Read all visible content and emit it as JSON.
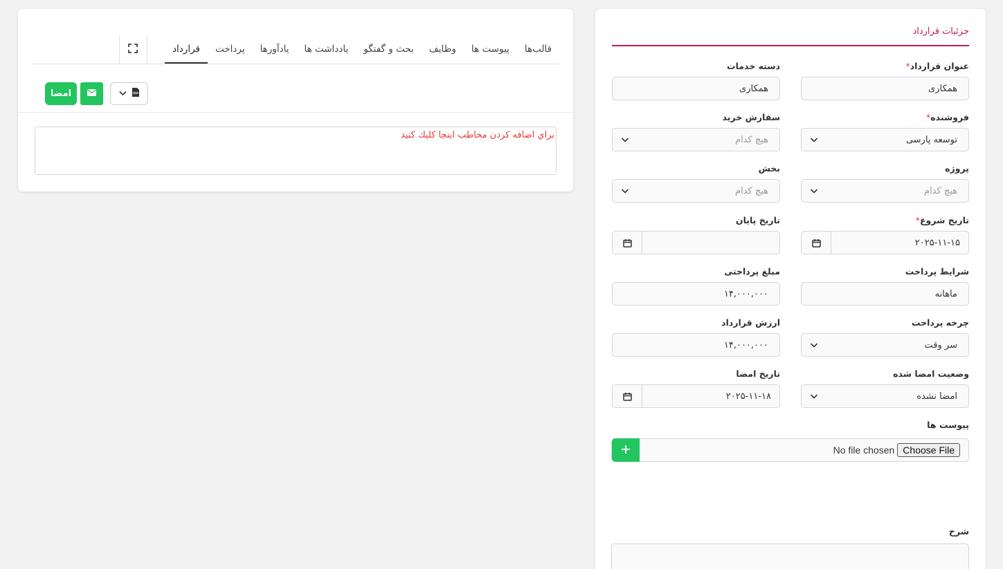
{
  "editor": {
    "tabs": [
      {
        "label": "قرارداد",
        "active": true
      },
      {
        "label": "پرداخت"
      },
      {
        "label": "یادآورها"
      },
      {
        "label": "یادداشت ها"
      },
      {
        "label": "بحث و گفتگو"
      },
      {
        "label": "وظایف"
      },
      {
        "label": "پیوست ها"
      },
      {
        "label": "قالب‌ها"
      }
    ],
    "sign_label": "امضا",
    "recipients_hint": "براي اضافه كردن مخاطب اينجا كليك كنيد",
    "icons": {
      "expand": "expand-icon",
      "mail": "envelope-icon",
      "pdf": "pdf-file-icon",
      "dropdown": "chevron-down-icon"
    }
  },
  "details": {
    "title": "جزئیات قرارداد",
    "fields": {
      "contract_title": {
        "label": "عنوان قرارداد",
        "required": true,
        "value": "همکاری"
      },
      "service_category": {
        "label": "دسته خدمات",
        "value": "همکاری"
      },
      "seller": {
        "label": "فروشنده",
        "required": true,
        "value": "توسعه پارسی"
      },
      "purchase_order": {
        "label": "سفارش خرید",
        "value": "هیچ کدام"
      },
      "project": {
        "label": "پروژه",
        "value": "هیچ کدام"
      },
      "section": {
        "label": "بخش",
        "value": "هیچ کدام"
      },
      "start_date": {
        "label": "تاریخ شروع",
        "required": true,
        "value": "۲۰۲۵-۱۱-۱۵"
      },
      "end_date": {
        "label": "تاریخ پایان",
        "value": ""
      },
      "payment_terms": {
        "label": "شرایط پرداخت",
        "value": "ماهانه"
      },
      "payment_amount": {
        "label": "مبلغ پرداختی",
        "value": "۱۴,۰۰۰,۰۰۰"
      },
      "payment_cycle": {
        "label": "چرخه پرداخت",
        "value": "سر وقت"
      },
      "contract_value": {
        "label": "ارزش قرارداد",
        "value": "۱۴,۰۰۰,۰۰۰"
      },
      "signed_status": {
        "label": "وضعیت امضا شده",
        "value": "امضا نشده"
      },
      "signed_date": {
        "label": "تاریخ امضا",
        "value": "۲۰۲۵-۱۱-۱۸"
      },
      "attachments": {
        "label": "پیوست ها",
        "button": "Choose File",
        "status": "No file chosen"
      },
      "description": {
        "label": "شرح",
        "value": ""
      }
    }
  },
  "colors": {
    "accent": "#c2185b",
    "success": "#22c55e",
    "required": "#e53935"
  }
}
